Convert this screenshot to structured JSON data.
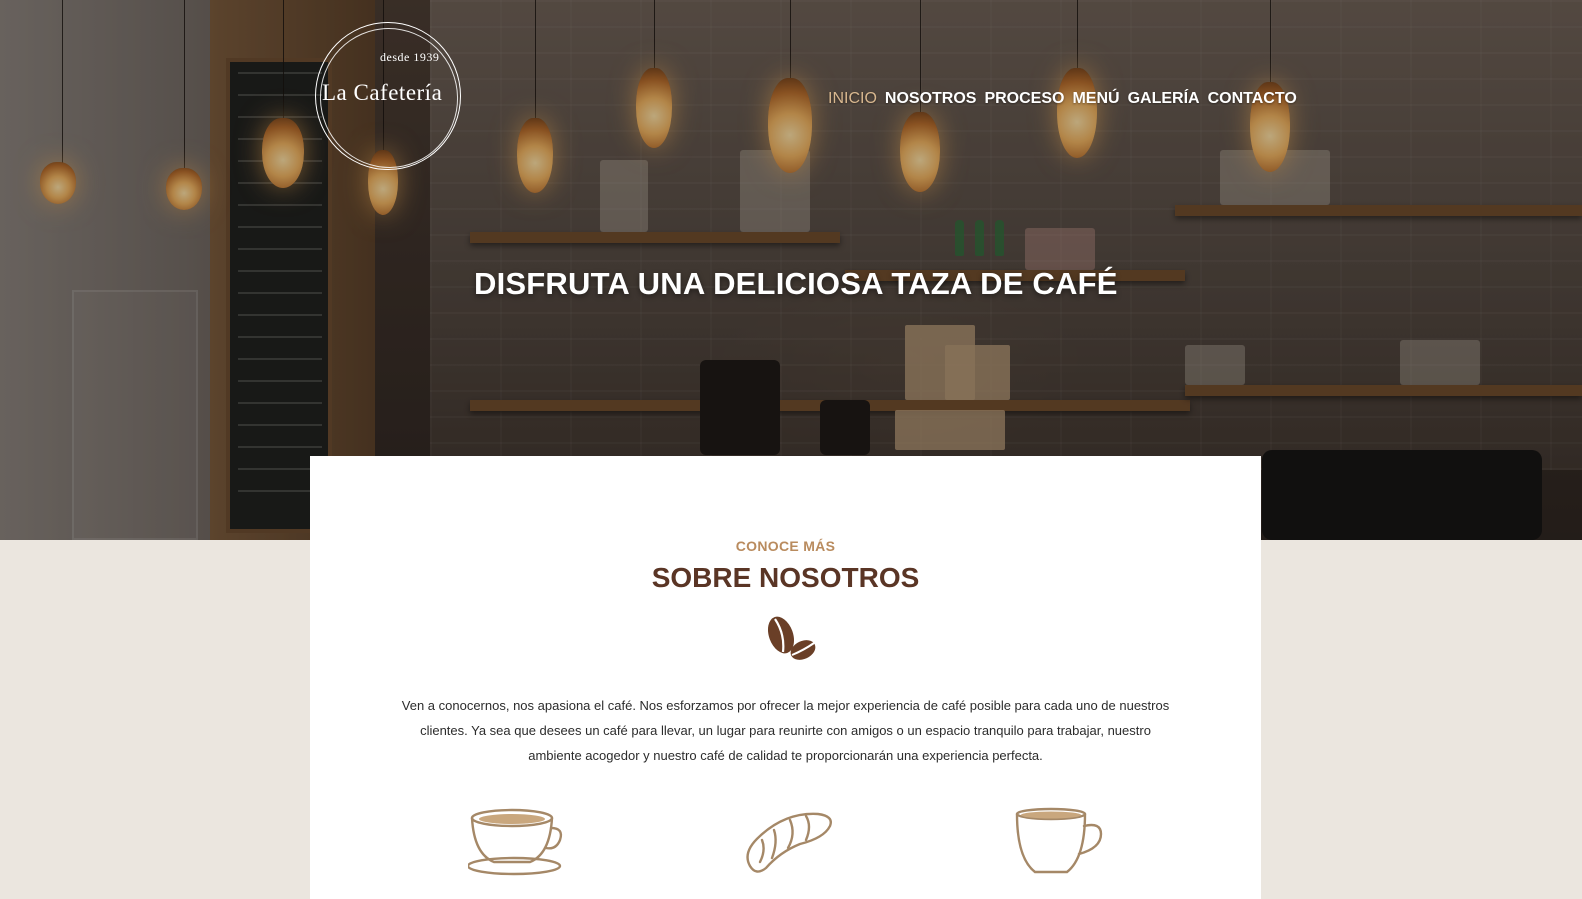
{
  "brand": {
    "since": "desde 1939",
    "name": "La Cafetería"
  },
  "nav": {
    "items": [
      {
        "label": "INICIO",
        "active": true
      },
      {
        "label": "NOSOTROS",
        "active": false
      },
      {
        "label": "PROCESO",
        "active": false
      },
      {
        "label": "MENÚ",
        "active": false
      },
      {
        "label": "GALERÍA",
        "active": false
      },
      {
        "label": "CONTACTO",
        "active": false
      }
    ],
    "active_color": "#d8b78f"
  },
  "hero": {
    "title": "DISFRUTA UNA DELICIOSA TAZA DE CAFÉ"
  },
  "about": {
    "eyebrow": "CONOCE MÁS",
    "title": "SOBRE NOSOTROS",
    "divider_icon": "coffee-beans-icon",
    "text": "Ven a conocernos, nos apasiona el café. Nos esforzamos por ofrecer la mejor experiencia de café posible para cada uno de nuestros clientes. Ya sea que desees un café para llevar, un lugar para reunirte con amigos o un espacio tranquilo para trabajar, nuestro ambiente acogedor y nuestro café de calidad te proporcionarán una experiencia perfecta.",
    "icons": [
      "coffee-cup-saucer-icon",
      "croissant-icon",
      "coffee-mug-icon"
    ]
  },
  "colors": {
    "accent": "#b98b5e",
    "title": "#5a3525",
    "page_bg": "#ebe6df",
    "card_bg": "#ffffff"
  }
}
